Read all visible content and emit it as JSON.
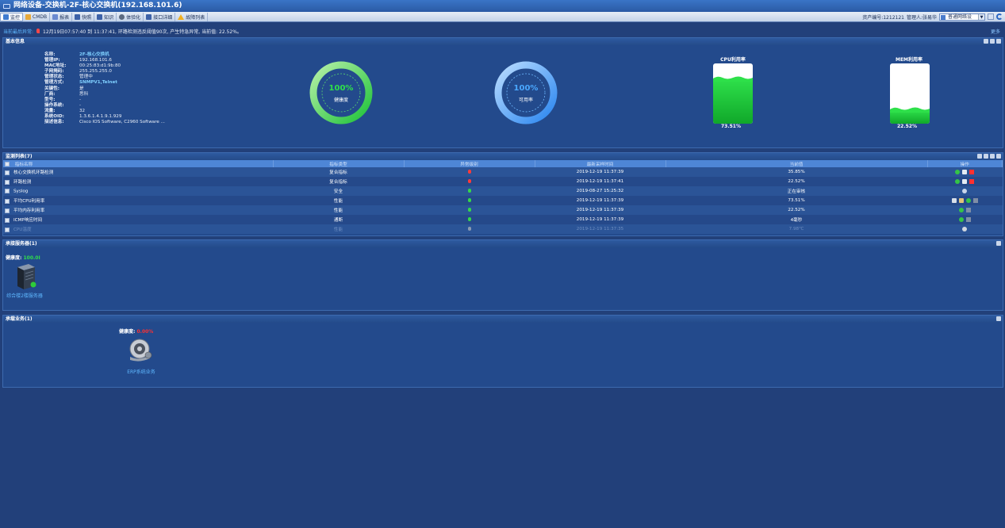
{
  "title": "网络设备-交换机-2F-核心交换机(192.168.101.6)",
  "toolbar": {
    "buttons": [
      "监控",
      "CMDB",
      "报表",
      "快照",
      "知识",
      "体验化",
      "接口详细",
      "故障列表"
    ],
    "asset_no": "资产编号:1212121",
    "manager": "管理人:张易华",
    "select_value": "普通网络设",
    "colors": {
      "accent": "#3a74c6"
    }
  },
  "alert": {
    "label": "当前最后异常:",
    "text": "12月19日07:57:40 到 11:37:41, 环路检测违反阈值90次, 产生特急异常, 当前值: 22.52%。",
    "more": "更多"
  },
  "basic": {
    "title": "基本信息",
    "rows": [
      {
        "k": "名称:",
        "v": "2F-核心交换机",
        "style": "hl"
      },
      {
        "k": "管理IP:",
        "v": "192.168.101.6",
        "style": ""
      },
      {
        "k": "MAC地址:",
        "v": "00:25:83:d1:9b:80",
        "style": ""
      },
      {
        "k": "子网掩码:",
        "v": "255.255.255.0",
        "style": ""
      },
      {
        "k": "管理状态:",
        "v": "管理中",
        "style": ""
      },
      {
        "k": "管理方式:",
        "v": "SNMPV1,Telnet",
        "style": "hl"
      },
      {
        "k": "关键性:",
        "v": "是",
        "style": ""
      },
      {
        "k": "厂商:",
        "v": "思科",
        "style": ""
      },
      {
        "k": "型号:",
        "v": "-",
        "style": ""
      },
      {
        "k": "操作系统:",
        "v": "-",
        "style": ""
      },
      {
        "k": "流量:",
        "v": "32",
        "style": ""
      },
      {
        "k": "系统OID:",
        "v": "1.3.6.1.4.1.9.1.929",
        "style": ""
      },
      {
        "k": "描述信息:",
        "v": "Cisco IOS Software, C2960 Software ...",
        "style": ""
      }
    ],
    "health": {
      "value": "100%",
      "label": "健康度",
      "level": 1.0,
      "color": "#2ee04a"
    },
    "availability": {
      "value": "100%",
      "label": "可用率",
      "level": 1.0,
      "color": "#4aa8ff"
    },
    "cpu": {
      "title": "CPU利用率",
      "value": "73.51%",
      "level": 0.7351
    },
    "mem": {
      "title": "MEM利用率",
      "value": "22.52%",
      "level": 0.2252
    }
  },
  "monitor": {
    "title": "监测列表(7)",
    "columns": [
      "指标名称",
      "指标类型",
      "异常级别",
      "最新采样时间",
      "当前值",
      "操作"
    ],
    "rows": [
      {
        "name": "核心交换机环路检测",
        "type": "复合指标",
        "level": "red",
        "time": "2019-12-19 11:37:39",
        "value": "35.85%",
        "ops": "full",
        "disabled": false
      },
      {
        "name": "环路检测",
        "type": "复合指标",
        "level": "red",
        "time": "2019-12-19 11:37:41",
        "value": "22.52%",
        "ops": "full",
        "disabled": false
      },
      {
        "name": "Syslog",
        "type": "安全",
        "level": "green",
        "time": "2019-08-27 15:25:32",
        "value": "正在审核",
        "ops": "search",
        "disabled": false
      },
      {
        "name": "平均CPU利用率",
        "type": "性能",
        "level": "green",
        "time": "2019-12-19 11:37:39",
        "value": "73.51%",
        "ops": "chart",
        "disabled": false
      },
      {
        "name": "平均内存利用率",
        "type": "性能",
        "level": "green",
        "time": "2019-12-19 11:37:39",
        "value": "22.52%",
        "ops": "small",
        "disabled": false
      },
      {
        "name": "ICMP响应时间",
        "type": "通断",
        "level": "green",
        "time": "2019-12-19 11:37:39",
        "value": "4毫秒",
        "ops": "small",
        "disabled": false
      },
      {
        "name": "CPU温度",
        "type": "性能",
        "level": "gray",
        "time": "2019-12-19 11:37:35",
        "value": "7.98℃",
        "ops": "one",
        "disabled": true
      }
    ]
  },
  "env": {
    "title": "承接服务器(1)",
    "health_label": "健康度:",
    "health_value": "100.0I",
    "server_label": "综合楼2楼服务器"
  },
  "biz": {
    "title": "承载业务(1)",
    "health_label": "健康度:",
    "health_value": "0.00%",
    "label": "ERP系统业务"
  }
}
